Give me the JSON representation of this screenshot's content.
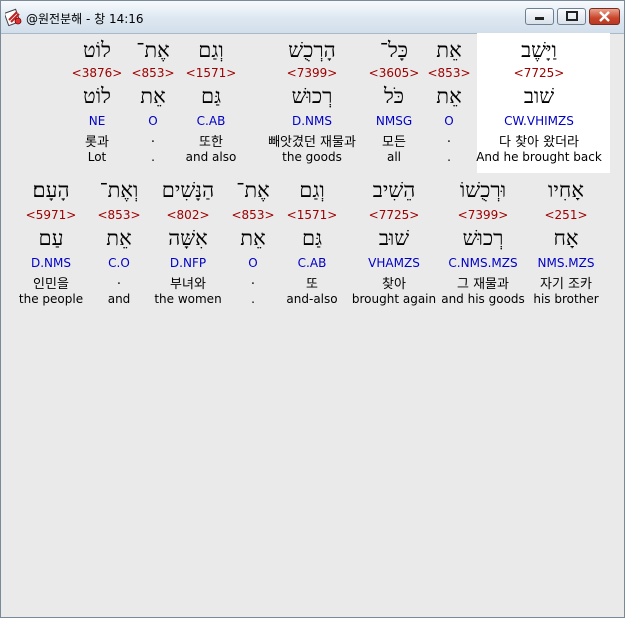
{
  "window": {
    "title": "@원전분해 - 창 14:16",
    "app_icon": "bible-book-icon",
    "buttons": {
      "minimize": "minimize-icon",
      "maximize": "maximize-icon",
      "close": "close-icon"
    },
    "accent": "#c9442a"
  },
  "colors": {
    "strong": "#a00000",
    "morph": "#0000c8",
    "highlight": "#ffffff"
  },
  "rows": [
    {
      "words": [
        {
          "hebrew": "וַיָּשֶׁב",
          "strong": "<7725>",
          "root": "שׁוב",
          "morph": "CW.VHIMZS",
          "korean": "다 찾아 왔더라",
          "english": "And he brought back"
        },
        {
          "hebrew": "אֵת",
          "strong": "<853>",
          "root": "אֵת",
          "morph": "O",
          "korean": ".",
          "english": "."
        },
        {
          "hebrew": "כָּל־",
          "strong": "<3605>",
          "root": "כֹּל",
          "morph": "NMSG",
          "korean": "모든",
          "english": "all"
        },
        {
          "hebrew": "הָרְכֻשׁ",
          "strong": "<7399>",
          "root": "רְכוּשׁ",
          "morph": "D.NMS",
          "korean": "빼앗겼던 재물과",
          "english": "the goods"
        },
        {
          "hebrew": "וְגַם",
          "strong": "<1571>",
          "root": "גַּם",
          "morph": "C.AB",
          "korean": "또한",
          "english": "and also"
        },
        {
          "hebrew": "אֶת־",
          "strong": "<853>",
          "root": "אֵת",
          "morph": "O",
          "korean": ".",
          "english": "."
        },
        {
          "hebrew": "לוֹט",
          "strong": "<3876>",
          "root": "לוֹט",
          "morph": "NE",
          "korean": "롯과",
          "english": "Lot"
        }
      ]
    },
    {
      "words": [
        {
          "hebrew": "אָחִיו",
          "strong": "<251>",
          "root": "אָח",
          "morph": "NMS.MZS",
          "korean": "자기 조카",
          "english": "his brother"
        },
        {
          "hebrew": "וּרְכֻשׁוֹ",
          "strong": "<7399>",
          "root": "רְכוּשׁ",
          "morph": "C.NMS.MZS",
          "korean": "그 재물과",
          "english": "and his goods"
        },
        {
          "hebrew": "הֵשִׁיב",
          "strong": "<7725>",
          "root": "שׁוּב",
          "morph": "VHAMZS",
          "korean": "찾아",
          "english": "brought again"
        },
        {
          "hebrew": "וְגַם",
          "strong": "<1571>",
          "root": "גַּם",
          "morph": "C.AB",
          "korean": "또",
          "english": "and-also"
        },
        {
          "hebrew": "אֶת־",
          "strong": "<853>",
          "root": "אֵת",
          "morph": "O",
          "korean": ".",
          "english": "."
        },
        {
          "hebrew": "הַנָּשִׁים",
          "strong": "<802>",
          "root": "אִשָּׁה",
          "morph": "D.NFP",
          "korean": "부녀와",
          "english": "the women"
        },
        {
          "hebrew": "וְאֶת־",
          "strong": "<853>",
          "root": "אֵת",
          "morph": "C.O",
          "korean": ".",
          "english": "and"
        },
        {
          "hebrew": "הָעָם׃",
          "strong": "<5971>",
          "root": "עַם",
          "morph": "D.NMS",
          "korean": "인민을",
          "english": "the people"
        }
      ]
    }
  ]
}
